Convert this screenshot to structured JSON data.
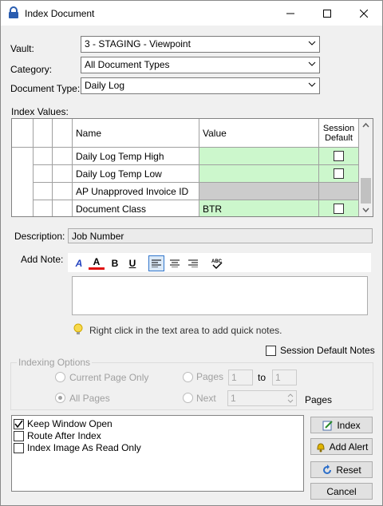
{
  "window": {
    "title": "Index Document"
  },
  "form": {
    "vault_label": "Vault:",
    "vault_value": "3 - STAGING - Viewpoint",
    "category_label": "Category:",
    "category_value": "All Document Types",
    "doctype_label": "Document Type:",
    "doctype_value": "Daily Log",
    "index_values_label": "Index Values:"
  },
  "grid": {
    "col_name": "Name",
    "col_value": "Value",
    "col_session": "Session Default",
    "rows": [
      {
        "name": "Daily Log Temp High",
        "value": "",
        "state": "editable"
      },
      {
        "name": "Daily Log Temp Low",
        "value": "",
        "state": "editable"
      },
      {
        "name": "AP Unapproved Invoice ID",
        "value": "",
        "state": "disabled"
      },
      {
        "name": "Document Class",
        "value": "BTR",
        "state": "editable"
      }
    ]
  },
  "description": {
    "label": "Description:",
    "value": "Job Number"
  },
  "note": {
    "label": "Add Note:",
    "hint": "Right click in the text area to add quick notes.",
    "session_default_notes": "Session Default Notes"
  },
  "indexing": {
    "legend": "Indexing Options",
    "current_page_only": "Current Page Only",
    "all_pages": "All Pages",
    "pages": "Pages",
    "from": "1",
    "to_label": "to",
    "to": "1",
    "next": "Next",
    "next_value": "1",
    "pages_suffix": "Pages"
  },
  "options": [
    "Keep Window Open",
    "Route After Index",
    "Index Image As Read Only"
  ],
  "options_checked": [
    true,
    false,
    false
  ],
  "buttons": {
    "index": "Index",
    "add_alert": "Add Alert",
    "reset": "Reset",
    "cancel": "Cancel"
  },
  "colors": {
    "editable": "#ccf7cc",
    "disabled": "#cccccc"
  }
}
